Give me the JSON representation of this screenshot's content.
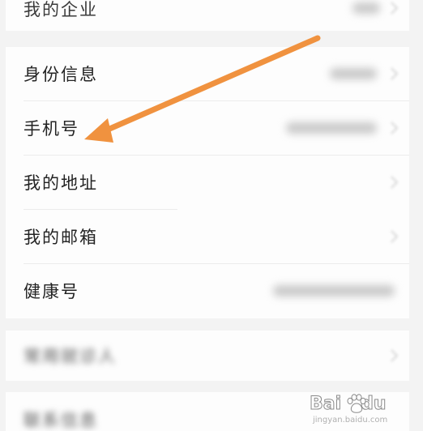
{
  "top_row": {
    "label": "我的企业"
  },
  "menu": {
    "items": [
      {
        "label": "身份信息"
      },
      {
        "label": "手机号"
      },
      {
        "label": "我的地址"
      },
      {
        "label": "我的邮箱"
      },
      {
        "label": "健康号"
      }
    ]
  },
  "lower_rows": [
    {
      "label": "常用就诊人"
    },
    {
      "label": "联系信息"
    }
  ],
  "annotation": {
    "type": "arrow",
    "color": "#f0923f"
  },
  "watermark": {
    "brand": "Bai",
    "brand_tail": "du",
    "sub": "jingyan.baidu.com"
  },
  "colors": {
    "background": "#f3f3f3",
    "card": "#fdfdfd",
    "divider": "#ececec",
    "label": "#232323"
  }
}
